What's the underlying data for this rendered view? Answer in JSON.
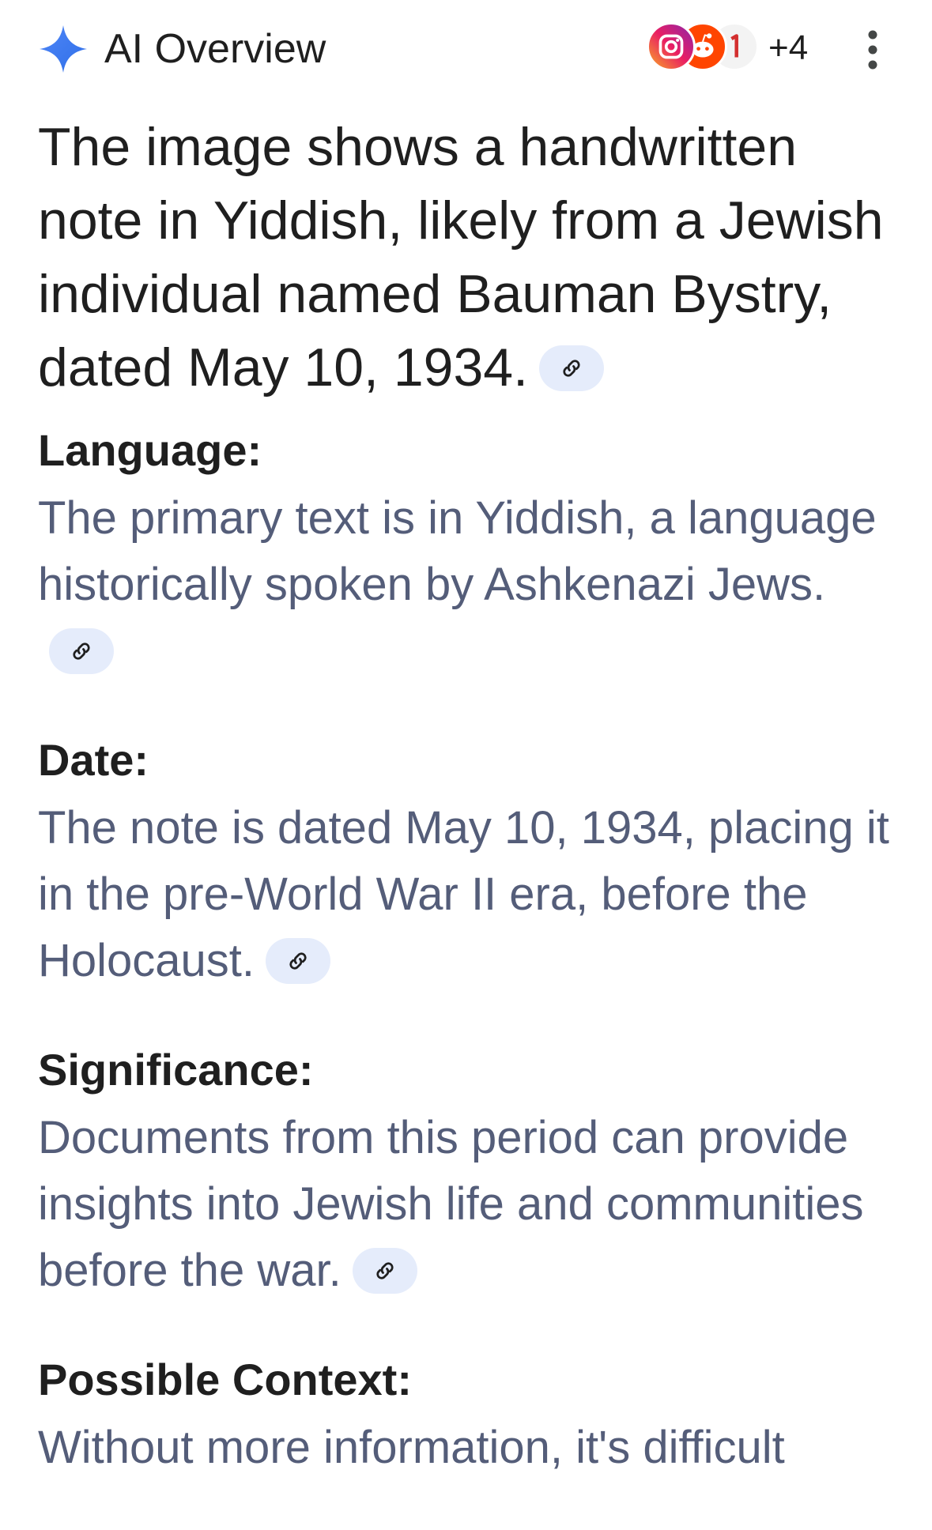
{
  "header": {
    "title": "AI Overview",
    "sources_more_count": "+4",
    "icons": [
      "sparkle-icon",
      "instagram-icon",
      "reddit-icon",
      "source-icon",
      "more-vert-icon"
    ]
  },
  "intro": "The image shows a handwritten note in Yiddish, likely from a Jewish individual named Bauman Bystry, dated May 10, 1934.",
  "sections": [
    {
      "heading": "Language:",
      "body": "The primary text is in Yiddish, a language historically spoken by Ashkenazi Jews."
    },
    {
      "heading": "Date:",
      "body": "The note is dated May 10, 1934, placing it in the pre-World War II era, before the Holocaust."
    },
    {
      "heading": "Significance:",
      "body": "Documents from this period can provide insights into Jewish life and communities before the war."
    },
    {
      "heading": "Possible Context:",
      "body": "Without more information, it's difficult"
    }
  ],
  "colors": {
    "accent_sparkle": "#4285f4",
    "chip_bg": "#e5ecfb",
    "body_text": "#545d79",
    "heading_text": "#1f1f1f"
  }
}
